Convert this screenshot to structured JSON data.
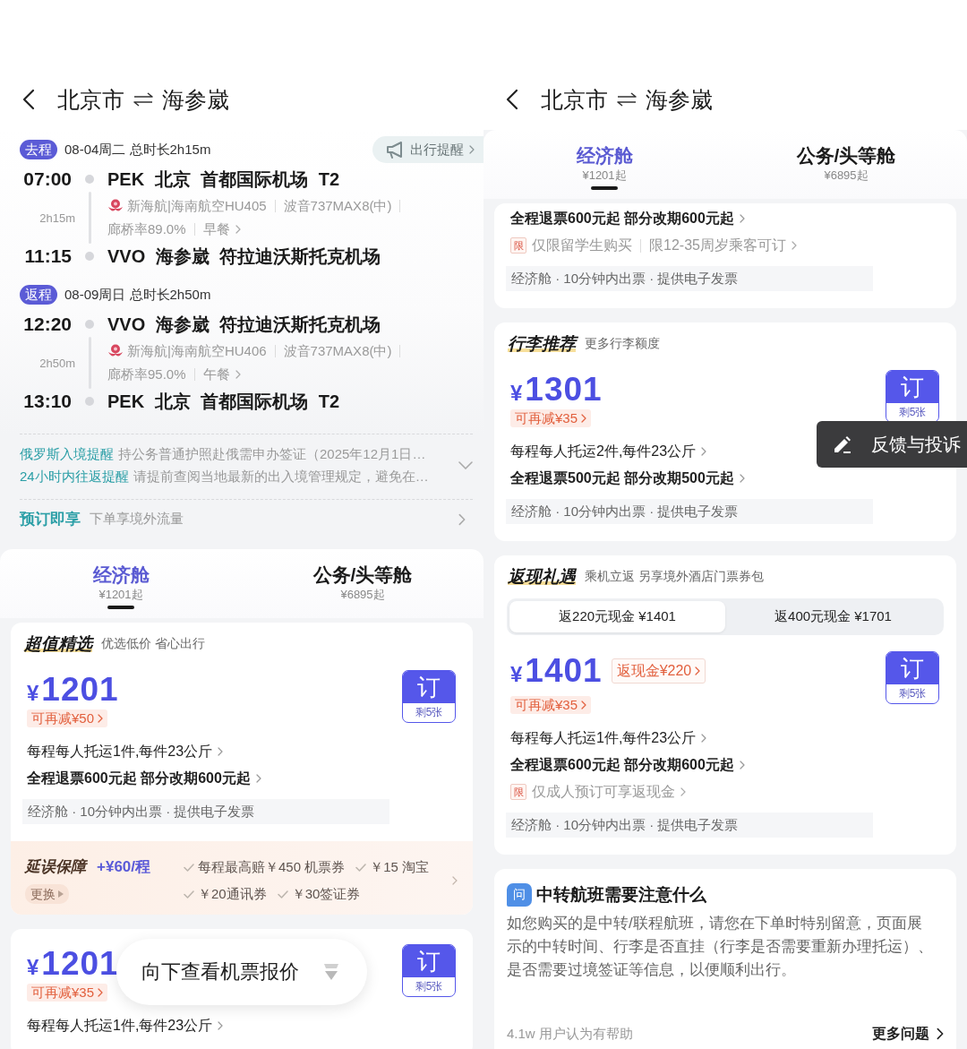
{
  "screens": [
    {
      "header": {
        "origin": "北京市",
        "destination": "海参崴"
      },
      "blocks": [
        {
          "kind": "itinerary",
          "reminder": "出行提醒",
          "legs": [
            {
              "badge": "去程",
              "summary": "08-04周二 总时长2h15m",
              "depart_time": "07:00",
              "depart_airport": "PEK 北京 首都国际机场 T2",
              "duration": "2h15m",
              "flight_info": [
                "新海航|海南航空HU405",
                "波音737MAX8(中)"
              ],
              "service_info": [
                "廊桥率89.0%",
                "早餐"
              ],
              "arrive_time": "11:15",
              "arrive_airport": "VVO 海参崴 符拉迪沃斯托克机场"
            },
            {
              "badge": "返程",
              "summary": "08-09周日 总时长2h50m",
              "depart_time": "12:20",
              "depart_airport": "VVO 海参崴 符拉迪沃斯托克机场",
              "duration": "2h50m",
              "flight_info": [
                "新海航|海南航空HU406",
                "波音737MAX8(中)"
              ],
              "service_info": [
                "廊桥率95.0%",
                "午餐"
              ],
              "arrive_time": "13:10",
              "arrive_airport": "PEK 北京 首都国际机场 T2"
            }
          ]
        },
        {
          "kind": "notices",
          "items": [
            {
              "title": "俄罗斯入境提醒",
              "text": "持公务普通护照赴俄需申办签证（2025年12月1日…"
            },
            {
              "title": "24小时内往返提醒",
              "text": "请提前查阅当地最新的出入境管理规定，避免在…"
            }
          ]
        },
        {
          "kind": "perk",
          "title": "预订即享",
          "text": "下单享境外流量"
        },
        {
          "kind": "cabin_tabs",
          "tabs": [
            {
              "label": "经济舱",
              "price": "¥1201起",
              "selected": true
            },
            {
              "label": "公务/头等舱",
              "price": "¥6895起",
              "selected": false
            }
          ]
        },
        {
          "kind": "fare",
          "heading": {
            "title": "超值精选",
            "subtitle": "优选低价 省心出行"
          },
          "price": {
            "currency": "¥",
            "amount": "1201"
          },
          "discount": "可再减¥50",
          "book": {
            "label": "订",
            "remaining": "剩5张"
          },
          "lines": [
            {
              "kind": "baggage",
              "text": "每程每人托运1件,每件23公斤"
            },
            {
              "kind": "refund",
              "text": "全程退票600元起 部分改期600元起"
            }
          ],
          "features": "经济舱 · 10分钟内出票 · 提供电子发票",
          "insurance": {
            "title": "延误保障",
            "price": "+¥60/程",
            "change": "更换",
            "benefits": [
              "每程最高赔￥450 机票券",
              "￥15 淘宝",
              "￥20通讯券",
              "￥30签证券"
            ]
          }
        },
        {
          "kind": "fare",
          "price": {
            "currency": "¥",
            "amount": "1201"
          },
          "discount": "可再减¥35",
          "book": {
            "label": "订",
            "remaining": "剩5张"
          },
          "lines": [
            {
              "kind": "baggage",
              "text": "每程每人托运1件,每件23公斤"
            }
          ]
        }
      ],
      "scroll_hint": "向下查看机票报价"
    },
    {
      "header": {
        "origin": "北京市",
        "destination": "海参崴"
      },
      "blocks": [
        {
          "kind": "cabin_tabs",
          "tabs": [
            {
              "label": "经济舱",
              "price": "¥1201起",
              "selected": true
            },
            {
              "label": "公务/头等舱",
              "price": "¥6895起",
              "selected": false
            }
          ]
        },
        {
          "kind": "fare",
          "lines": [
            {
              "kind": "refund",
              "text": "全程退票600元起 部分改期600元起"
            },
            {
              "kind": "restriction",
              "tag": "限",
              "parts": [
                "仅限留学生购买",
                "限12-35周岁乘客可订"
              ]
            }
          ],
          "features": "经济舱 · 10分钟内出票 · 提供电子发票"
        },
        {
          "kind": "fare",
          "heading": {
            "title": "行李推荐",
            "subtitle": "更多行李额度"
          },
          "price": {
            "currency": "¥",
            "amount": "1301"
          },
          "discount": "可再减¥35",
          "book": {
            "label": "订",
            "remaining": "剩5张"
          },
          "lines": [
            {
              "kind": "baggage",
              "text": "每程每人托运2件,每件23公斤"
            },
            {
              "kind": "refund",
              "text": "全程退票500元起 部分改期500元起"
            }
          ],
          "features": "经济舱 · 10分钟内出票 · 提供电子发票"
        },
        {
          "kind": "fare",
          "heading": {
            "title": "返现礼遇",
            "subtitle": "乘机立返 另享境外酒店门票券包"
          },
          "options": [
            {
              "label": "返220元现金 ¥1401",
              "selected": true
            },
            {
              "label": "返400元现金 ¥1701",
              "selected": false
            }
          ],
          "price": {
            "currency": "¥",
            "amount": "1401"
          },
          "cashback": "返现金¥220",
          "discount": "可再减¥35",
          "book": {
            "label": "订",
            "remaining": "剩5张"
          },
          "lines": [
            {
              "kind": "baggage",
              "text": "每程每人托运1件,每件23公斤"
            },
            {
              "kind": "refund",
              "text": "全程退票600元起 部分改期600元起"
            },
            {
              "kind": "restriction",
              "tag": "限",
              "parts": [
                "仅成人预订可享返现金"
              ]
            }
          ],
          "features": "经济舱 · 10分钟内出票 · 提供电子发票"
        },
        {
          "kind": "faq",
          "badge": "问",
          "title": "中转航班需要注意什么",
          "body": "如您购买的是中转/联程航班，请您在下单时特别留意，页面展示的中转时间、行李是否直挂（行李是否需要重新办理托运）、是否需要过境签证等信息，以便顺利出行。",
          "helpful": "4.1w 用户认为有帮助",
          "more": "更多问题"
        }
      ],
      "feedback": "反馈与投诉"
    }
  ]
}
